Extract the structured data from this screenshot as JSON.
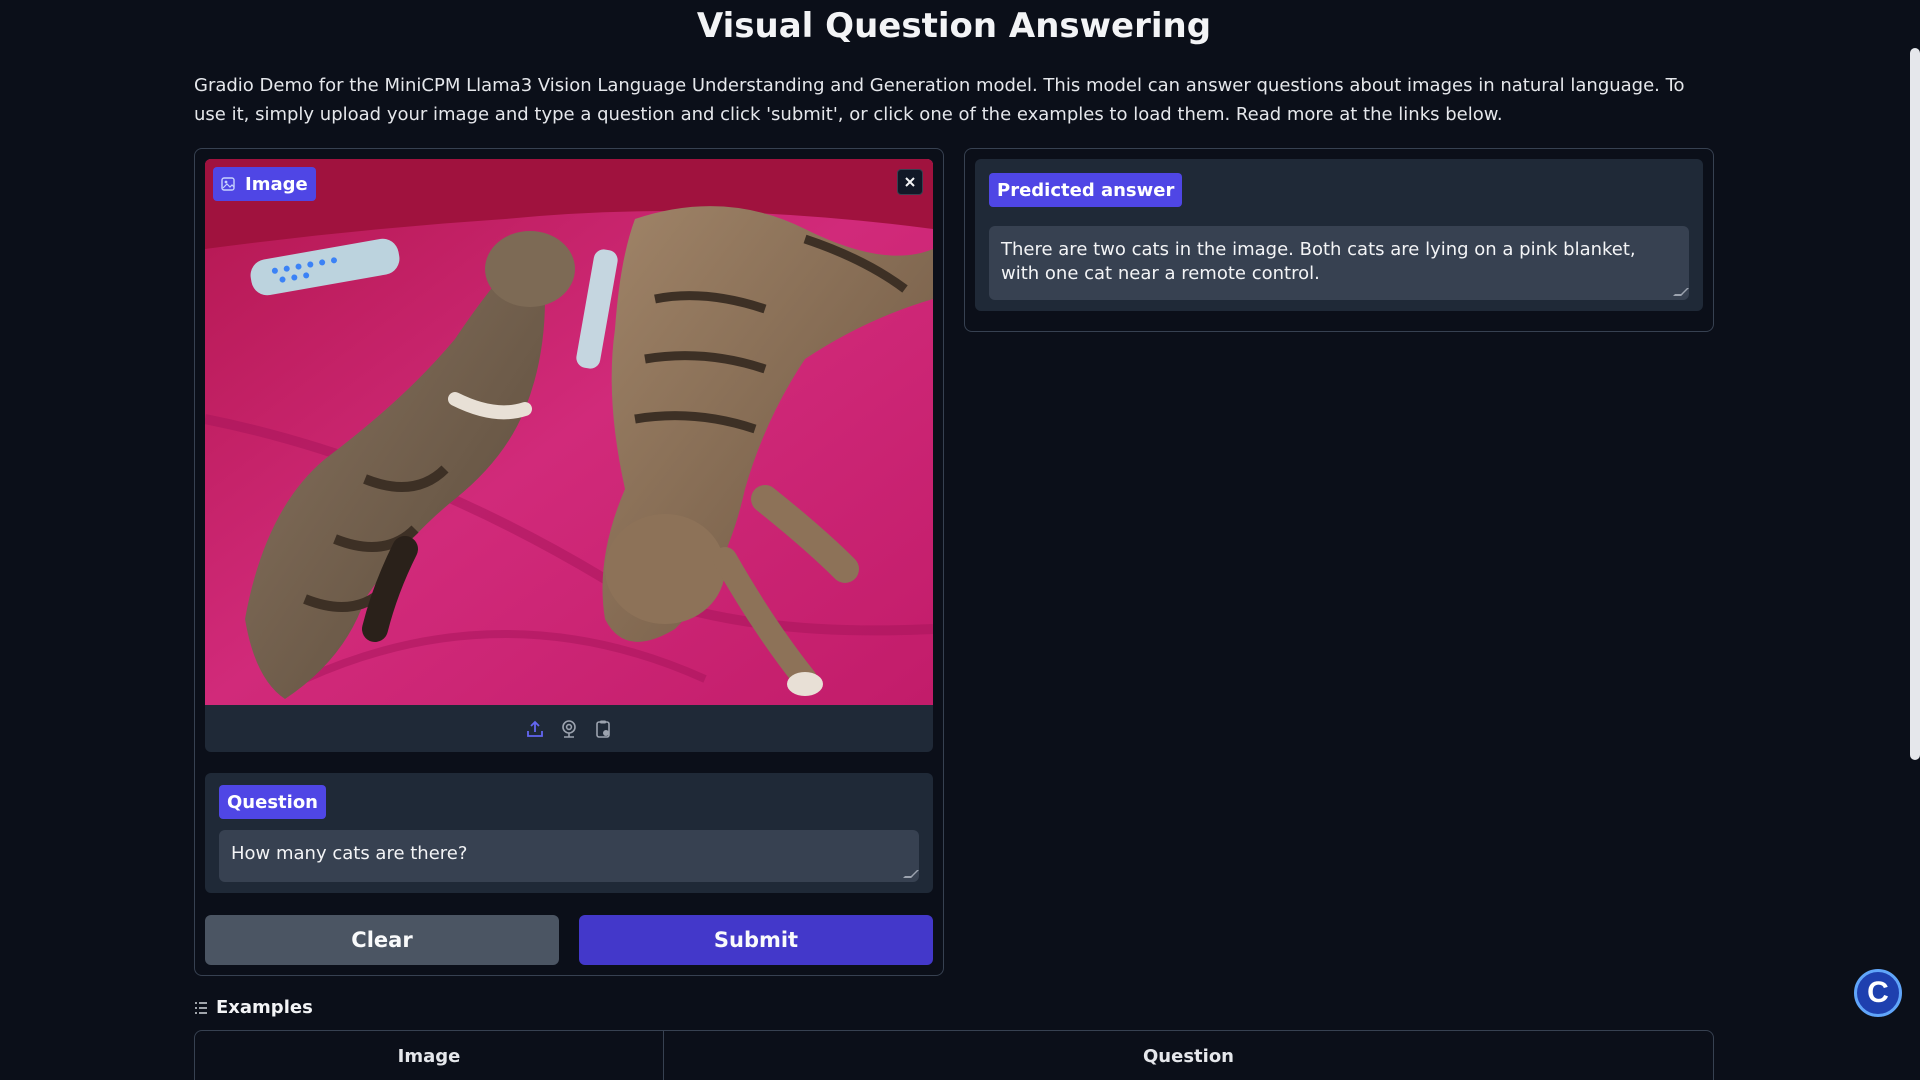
{
  "page": {
    "title": "Visual Question Answering",
    "description": "Gradio Demo for the MiniCPM Llama3 Vision Language Understanding and Generation model. This model can answer questions about images in natural language. To use it, simply upload your image and type a question and click 'submit', or click one of the examples to load them. Read more at the links below."
  },
  "image_input": {
    "label": "Image",
    "icon": "image-icon",
    "source_icons": [
      "upload-icon",
      "webcam-icon",
      "clipboard-icon"
    ],
    "close_icon": "close-icon"
  },
  "question": {
    "label": "Question",
    "value": "How many cats are there?"
  },
  "buttons": {
    "clear": "Clear",
    "submit": "Submit"
  },
  "answer": {
    "label": "Predicted answer",
    "value": "There are two cats in the image. Both cats are lying on a pink blanket, with one cat near a remote control."
  },
  "examples": {
    "header": "Examples",
    "columns": [
      "Image",
      "Question"
    ]
  },
  "badge": {
    "letter": "C"
  },
  "colors": {
    "background": "#0b0f19",
    "accent": "#4f46e5",
    "submit": "#4338ca",
    "clear": "#4b5563",
    "panel": "#1f2937"
  }
}
